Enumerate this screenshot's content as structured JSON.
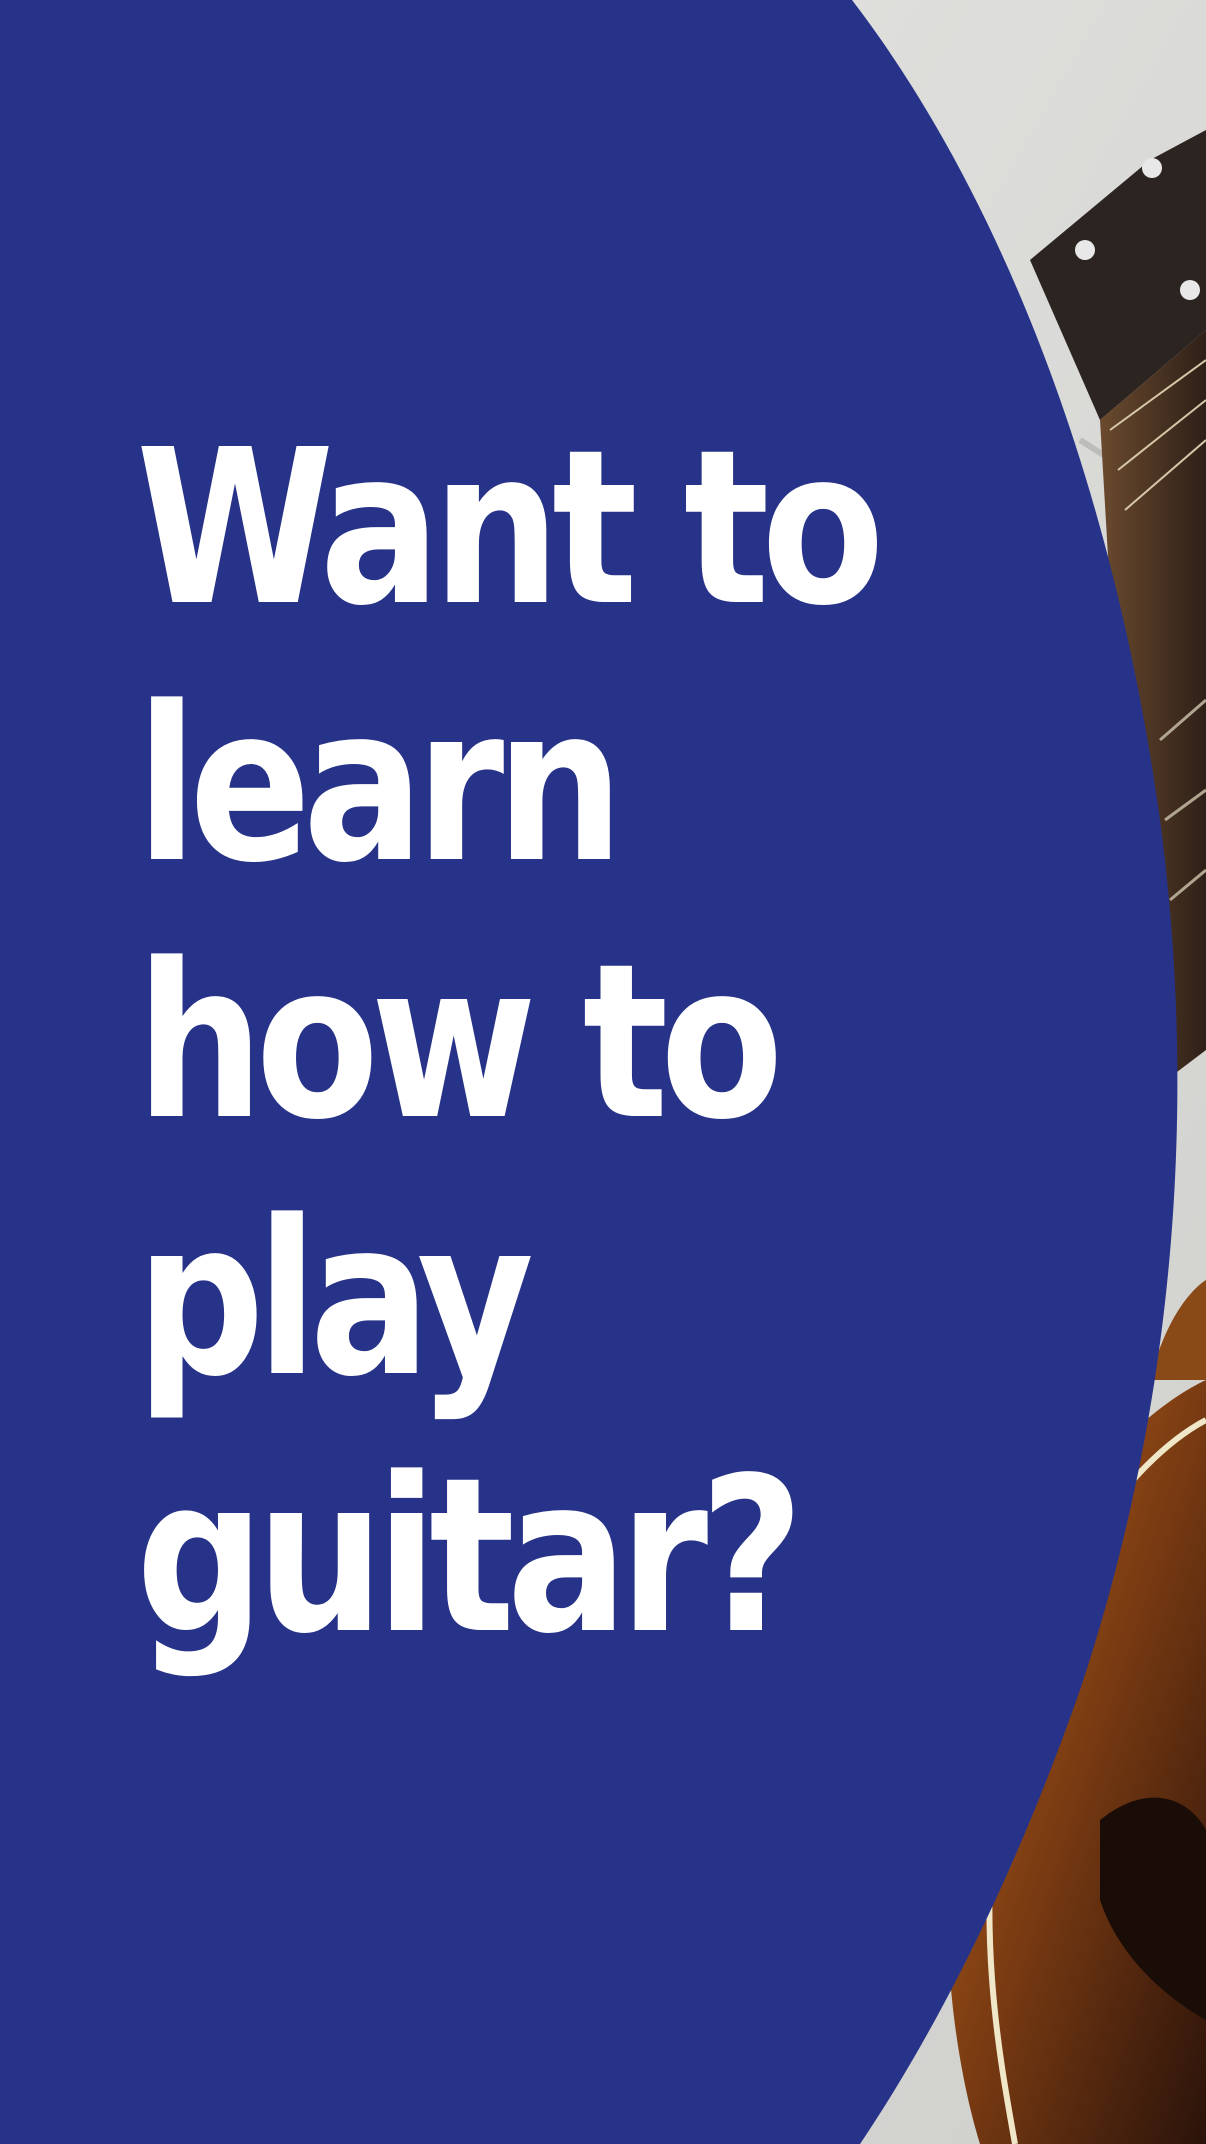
{
  "headline": {
    "lines": [
      "Want to",
      "learn",
      "how to",
      "play",
      "guitar?"
    ]
  },
  "colors": {
    "panel": "#273389",
    "text": "#ffffff",
    "wall": "#dcdcdc",
    "guitar_body": "#7a3b12",
    "guitar_neck": "#3b2a1e"
  },
  "image": {
    "subject": "guitar-photo"
  }
}
